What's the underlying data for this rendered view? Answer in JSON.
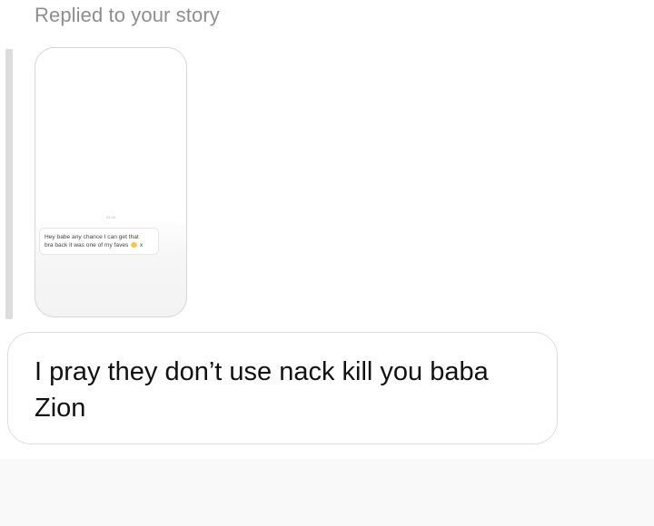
{
  "reply_header": "Replied to your story",
  "story": {
    "timestamp": "03:18",
    "line1": "Hey babe any chance I can get that",
    "line2": "bra back it was one of my faves",
    "emoji_icon": "pouting-face-emoji",
    "suffix": "x"
  },
  "message": {
    "text": "I pray they don’t use nack kill you baba Zion"
  },
  "colors": {
    "header_text": "#8e8e8e",
    "bubble_border": "#dedede",
    "message_text": "#111111"
  }
}
